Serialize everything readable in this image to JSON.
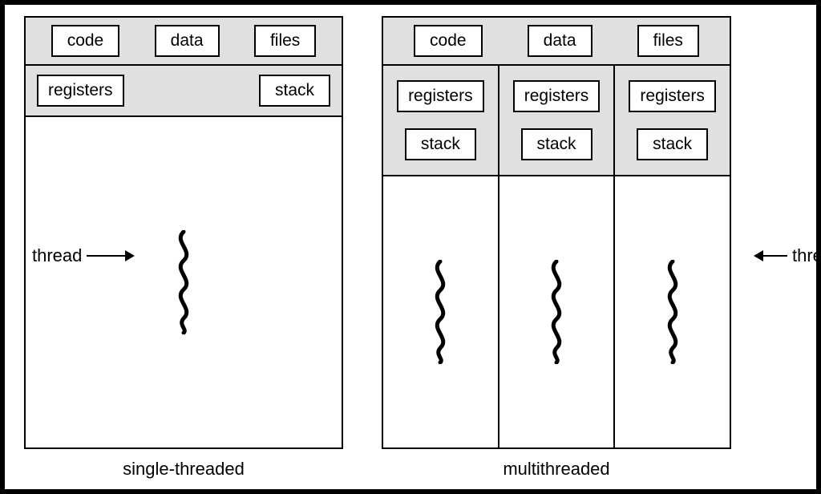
{
  "shared_labels": {
    "code": "code",
    "data": "data",
    "files": "files"
  },
  "perthread_labels": {
    "registers": "registers",
    "stack": "stack"
  },
  "captions": {
    "single": "single-threaded",
    "multi": "multithreaded"
  },
  "annotations": {
    "thread": "thread"
  },
  "multi_thread_count": 3
}
